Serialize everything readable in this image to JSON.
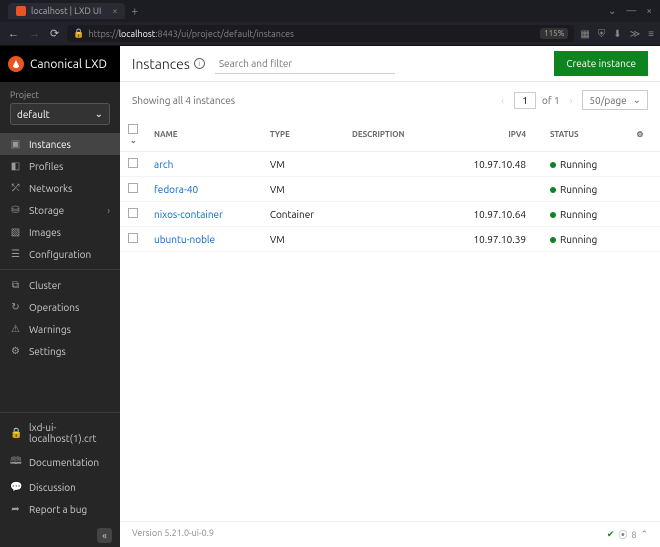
{
  "browser": {
    "tab_title": "localhost | LXD UI",
    "url_prefix": "https://",
    "url_host": "localhost",
    "url_path": ":8443/ui/project/default/instances",
    "zoom": "115%"
  },
  "brand": {
    "name": "Canonical LXD"
  },
  "project": {
    "label": "Project",
    "value": "default"
  },
  "nav": {
    "instances": "Instances",
    "profiles": "Profiles",
    "networks": "Networks",
    "storage": "Storage",
    "images": "Images",
    "configuration": "Configuration",
    "cluster": "Cluster",
    "operations": "Operations",
    "warnings": "Warnings",
    "settings": "Settings"
  },
  "bottom": {
    "cert": "lxd-ui-localhost(1).crt",
    "docs": "Documentation",
    "discussion": "Discussion",
    "bug": "Report a bug"
  },
  "header": {
    "title": "Instances",
    "search_placeholder": "Search and filter",
    "create": "Create instance"
  },
  "toolbar": {
    "summary": "Showing all 4 instances",
    "page": "1",
    "of": "of 1",
    "perpage": "50/page"
  },
  "columns": {
    "name": "Name",
    "type": "Type",
    "description": "Description",
    "ipv4": "IPv4",
    "status": "Status"
  },
  "rows": [
    {
      "name": "arch",
      "type": "VM",
      "desc": "",
      "ipv4": "10.97.10.48",
      "status": "Running"
    },
    {
      "name": "fedora-40",
      "type": "VM",
      "desc": "",
      "ipv4": "",
      "status": "Running"
    },
    {
      "name": "nixos-container",
      "type": "Container",
      "desc": "",
      "ipv4": "10.97.10.64",
      "status": "Running"
    },
    {
      "name": "ubuntu-noble",
      "type": "VM",
      "desc": "",
      "ipv4": "10.97.10.39",
      "status": "Running"
    }
  ],
  "footer": {
    "version": "Version 5.21.0-ui-0.9",
    "members": "8"
  }
}
